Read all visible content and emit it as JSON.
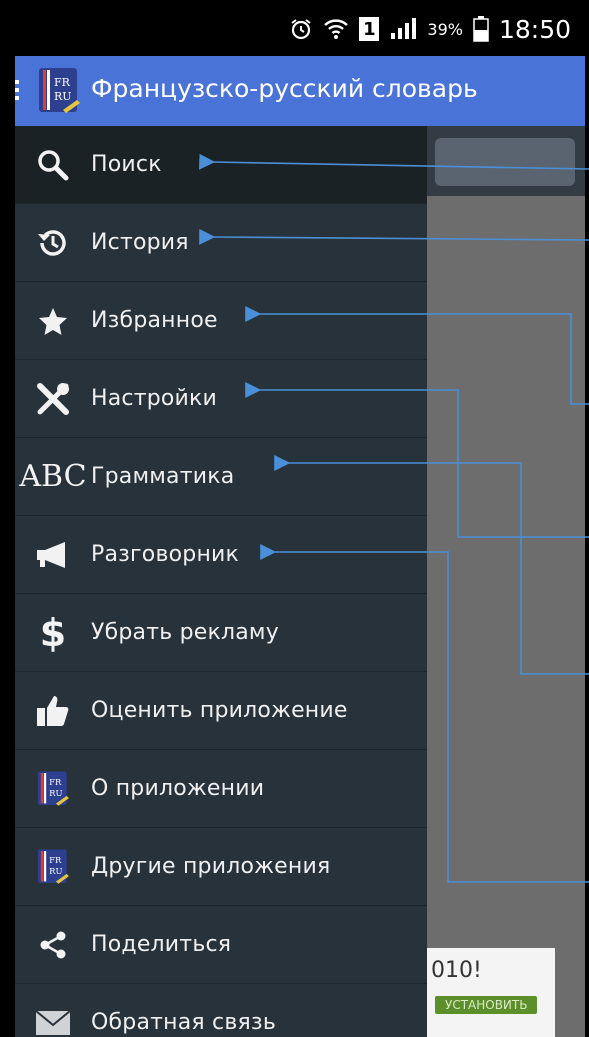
{
  "status_bar": {
    "battery_percent": "39%",
    "time": "18:50",
    "sim_label": "1",
    "icons": [
      "alarm-icon",
      "wifi-icon",
      "sim-icon",
      "signal-icon",
      "battery-icon"
    ]
  },
  "appbar": {
    "title": "Французско-русский словарь",
    "logo_text_top": "FR",
    "logo_text_bottom": "RU"
  },
  "drawer": {
    "items": [
      {
        "label": "Поиск",
        "icon": "search-icon"
      },
      {
        "label": "История",
        "icon": "history-icon"
      },
      {
        "label": "Избранное",
        "icon": "star-icon"
      },
      {
        "label": "Настройки",
        "icon": "tools-icon"
      },
      {
        "label": "Грамматика",
        "icon": "abc-icon",
        "icon_text": "ABC"
      },
      {
        "label": "Разговорник",
        "icon": "megaphone-icon"
      },
      {
        "label": "Убрать рекламу",
        "icon": "dollar-icon",
        "icon_text": "$"
      },
      {
        "label": "Оценить приложение",
        "icon": "thumbs-up-icon"
      },
      {
        "label": "О приложении",
        "icon": "app-logo-icon"
      },
      {
        "label": "Другие приложения",
        "icon": "app-logo-icon"
      },
      {
        "label": "Поделиться",
        "icon": "share-icon"
      },
      {
        "label": "Обратная связь",
        "icon": "mail-icon"
      }
    ]
  },
  "ad": {
    "text": "010!",
    "install_label": "УСТАНОВИТЬ"
  },
  "colors": {
    "appbar": "#4a73d8",
    "drawer": "#27323a",
    "arrow": "#4a8fd8"
  }
}
